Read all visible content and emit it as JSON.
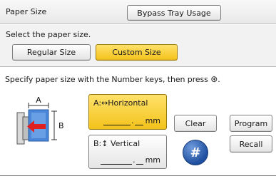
{
  "header": {
    "title": "Paper Size",
    "bypass_label": "Bypass Tray Usage"
  },
  "size_select": {
    "prompt": "Select the paper size.",
    "regular_label": "Regular Size",
    "custom_label": "Custom Size",
    "selected": "Custom Size"
  },
  "instruction": {
    "text": "Specify paper size with the Number keys, then press",
    "start_icon": "start-key-icon",
    "end": "."
  },
  "diagram": {
    "label_a": "A",
    "label_b": "B",
    "icon": "paper-orientation-icon",
    "arrow_color": "#e02020",
    "paper_color": "#4a86d8"
  },
  "fields": {
    "a": {
      "label": "A:↔Horizontal",
      "unit": "mm",
      "value": ""
    },
    "b": {
      "label": "B:↕ Vertical",
      "unit": "mm",
      "value": ""
    }
  },
  "keys": {
    "clear_label": "Clear",
    "program_label": "Program",
    "recall_label": "Recall",
    "hash_label": "#"
  },
  "colors": {
    "selected_yellow": "#f3c21b",
    "hash_blue": "#1f4f9f"
  }
}
